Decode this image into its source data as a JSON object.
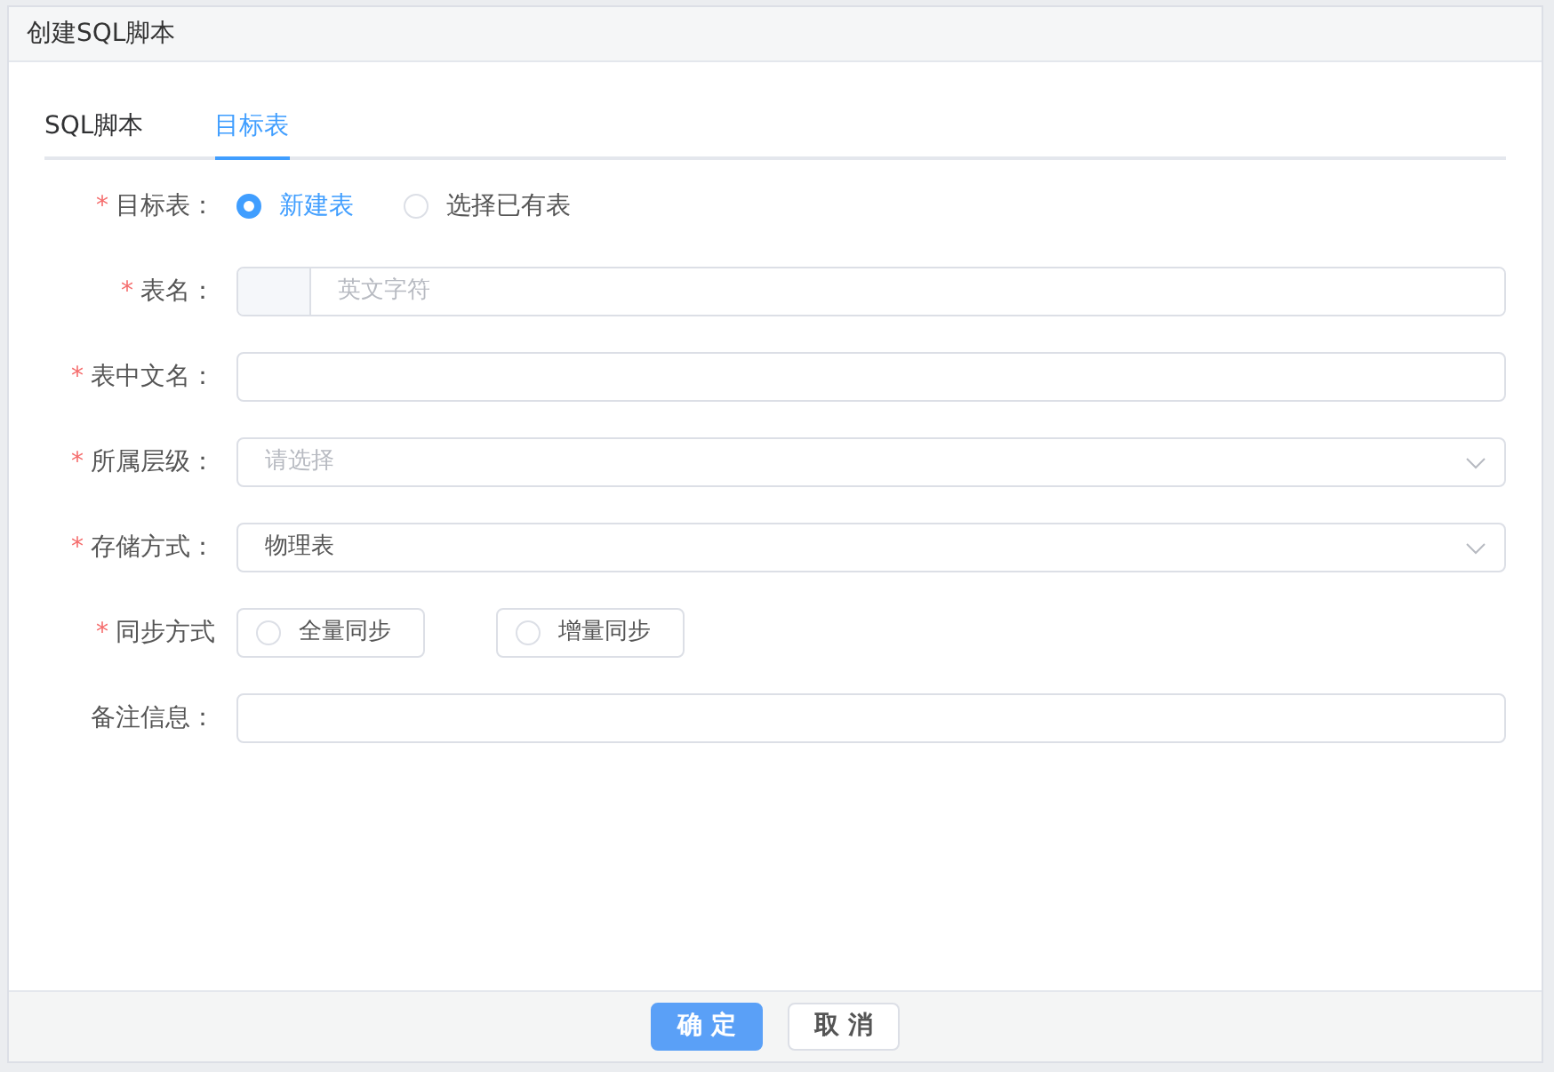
{
  "dialog": {
    "title": "创建SQL脚本"
  },
  "tabs": [
    {
      "label": "SQL脚本",
      "selected": false
    },
    {
      "label": "目标表",
      "selected": true
    }
  ],
  "fields": [
    {
      "kind": "radio",
      "label": "目标表：",
      "required_mark": "*",
      "options": [
        {
          "label": "新建表",
          "selected": true
        },
        {
          "label": "选择已有表",
          "selected": false
        }
      ]
    },
    {
      "kind": "prefixed-input",
      "label": "表名：",
      "required_mark": "*",
      "placeholder": "英文字符"
    },
    {
      "kind": "input",
      "label": "表中文名：",
      "required_mark": "*"
    },
    {
      "kind": "select",
      "label": "所属层级：",
      "required_mark": "*",
      "placeholder": "请选择"
    },
    {
      "kind": "select",
      "label": "存储方式：",
      "required_mark": "*",
      "value": "物理表"
    },
    {
      "kind": "radio-box",
      "label": "同步方式",
      "required_mark": "*",
      "options": [
        {
          "label": "全量同步",
          "selected": false
        },
        {
          "label": "增量同步",
          "selected": false
        }
      ]
    },
    {
      "kind": "input",
      "label": "备注信息："
    }
  ],
  "buttons": [
    {
      "label": "确 定",
      "kind": "primary"
    },
    {
      "label": "取 消",
      "kind": "default"
    }
  ]
}
